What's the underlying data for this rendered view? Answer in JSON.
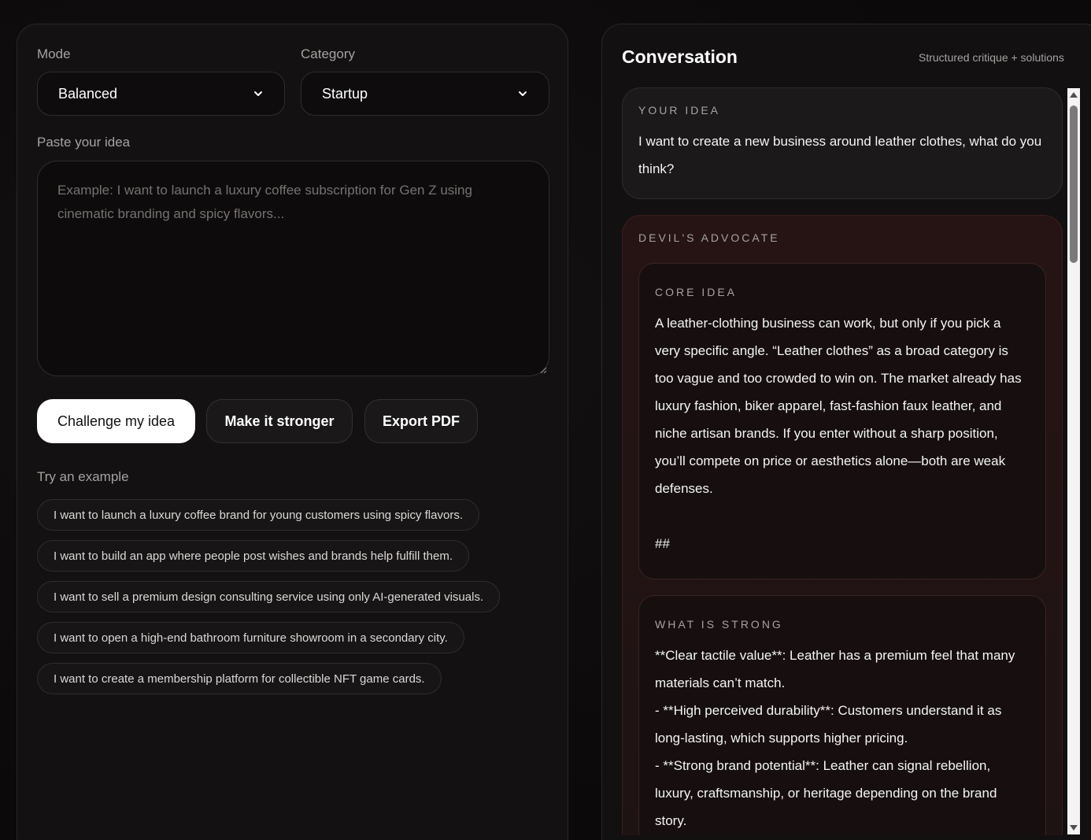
{
  "left": {
    "mode_label": "Mode",
    "mode_value": "Balanced",
    "category_label": "Category",
    "category_value": "Startup",
    "idea_label": "Paste your idea",
    "idea_placeholder": "Example: I want to launch a luxury coffee subscription for Gen Z using cinematic branding and spicy flavors...",
    "buttons": {
      "challenge": "Challenge my idea",
      "stronger": "Make it stronger",
      "export": "Export PDF"
    },
    "examples_label": "Try an example",
    "examples": [
      "I want to launch a luxury coffee brand for young customers using spicy flavors.",
      "I want to build an app where people post wishes and brands help fulfill them.",
      "I want to sell a premium design consulting service using only AI-generated visuals.",
      "I want to open a high-end bathroom furniture showroom in a secondary city.",
      "I want to create a membership platform for collectible NFT game cards."
    ]
  },
  "right": {
    "title": "Conversation",
    "subtitle": "Structured critique + solutions",
    "idea_card": {
      "heading": "YOUR IDEA",
      "text": "I want to create a new business around leather clothes, what do you think?"
    },
    "devil_card": {
      "heading": "DEVIL'S ADVOCATE",
      "core": {
        "heading": "CORE IDEA",
        "text": "A leather-clothing business can work, but only if you pick a very specific angle. “Leather clothes” as a broad category is too vague and too crowded to win on. The market already has luxury fashion, biker apparel, fast-fashion faux leather, and niche artisan brands. If you enter without a sharp position, you’ll compete on price or aesthetics alone—both are weak defenses.",
        "trailing": "##"
      },
      "strong": {
        "heading": "WHAT IS STRONG",
        "lines": [
          "**Clear tactile value**: Leather has a premium feel that many materials can’t match.",
          "- **High perceived durability**: Customers understand it as long-lasting, which supports higher pricing.",
          "- **Strong brand potential**: Leather can signal rebellion, luxury, craftsmanship, or heritage depending on the brand story."
        ]
      }
    }
  },
  "colors": {
    "background": "#0c0a0a",
    "panel": "#131111",
    "devil_card": "#261414",
    "primary_button": "#ffffff"
  },
  "icons": {
    "select_arrow": "chevron-down-icon",
    "scroll_up": "scroll-up-arrow-icon",
    "scroll_down": "scroll-down-arrow-icon"
  }
}
